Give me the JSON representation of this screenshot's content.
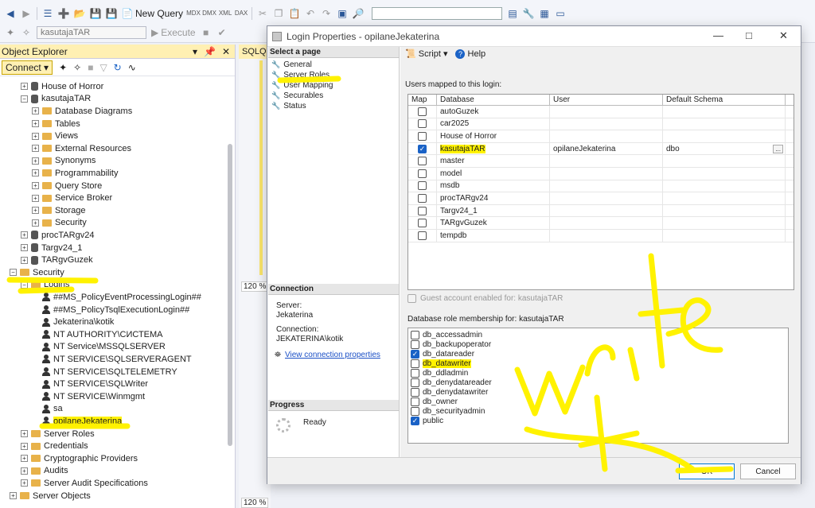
{
  "toolbar": {
    "new_query": "New Query",
    "database_value": "kasutajaTAR",
    "execute": "Execute"
  },
  "object_explorer": {
    "title": "Object Explorer",
    "connect": "Connect",
    "tree": [
      {
        "label": "House of Horror",
        "type": "db",
        "level": 1
      },
      {
        "label": "kasutajaTAR",
        "type": "db",
        "level": 1,
        "expanded": true
      },
      {
        "label": "Database Diagrams",
        "type": "folder",
        "level": 2
      },
      {
        "label": "Tables",
        "type": "folder",
        "level": 2
      },
      {
        "label": "Views",
        "type": "folder",
        "level": 2
      },
      {
        "label": "External Resources",
        "type": "folder",
        "level": 2
      },
      {
        "label": "Synonyms",
        "type": "folder",
        "level": 2
      },
      {
        "label": "Programmability",
        "type": "folder",
        "level": 2
      },
      {
        "label": "Query Store",
        "type": "folder",
        "level": 2
      },
      {
        "label": "Service Broker",
        "type": "folder",
        "level": 2
      },
      {
        "label": "Storage",
        "type": "folder",
        "level": 2
      },
      {
        "label": "Security",
        "type": "folder",
        "level": 2
      },
      {
        "label": "procTARgv24",
        "type": "db",
        "level": 1
      },
      {
        "label": "Targv24_1",
        "type": "db",
        "level": 1
      },
      {
        "label": "TARgvGuzek",
        "type": "db",
        "level": 1
      },
      {
        "label": "Security",
        "type": "folder",
        "level": 0,
        "expanded": true
      },
      {
        "label": "Logins",
        "type": "folder",
        "level": 1,
        "expanded": true
      },
      {
        "label": "##MS_PolicyEventProcessingLogin##",
        "type": "user",
        "level": 2
      },
      {
        "label": "##MS_PolicyTsqlExecutionLogin##",
        "type": "user",
        "level": 2
      },
      {
        "label": "Jekaterina\\kotik",
        "type": "user",
        "level": 2
      },
      {
        "label": "NT AUTHORITY\\СИСТЕМА",
        "type": "user",
        "level": 2
      },
      {
        "label": "NT Service\\MSSQLSERVER",
        "type": "user",
        "level": 2
      },
      {
        "label": "NT SERVICE\\SQLSERVERAGENT",
        "type": "user",
        "level": 2
      },
      {
        "label": "NT SERVICE\\SQLTELEMETRY",
        "type": "user",
        "level": 2
      },
      {
        "label": "NT SERVICE\\SQLWriter",
        "type": "user",
        "level": 2
      },
      {
        "label": "NT SERVICE\\Winmgmt",
        "type": "user",
        "level": 2
      },
      {
        "label": "sa",
        "type": "user",
        "level": 2
      },
      {
        "label": "opilaneJekaterina",
        "type": "user",
        "level": 2,
        "selected": true
      },
      {
        "label": "Server Roles",
        "type": "folder",
        "level": 1
      },
      {
        "label": "Credentials",
        "type": "folder",
        "level": 1
      },
      {
        "label": "Cryptographic Providers",
        "type": "folder",
        "level": 1
      },
      {
        "label": "Audits",
        "type": "folder",
        "level": 1
      },
      {
        "label": "Server Audit Specifications",
        "type": "folder",
        "level": 1
      },
      {
        "label": "Server Objects",
        "type": "folder",
        "level": 0
      }
    ]
  },
  "editor": {
    "tab": "SQLQu",
    "zoom": "120 %",
    "zoom_bottom": "120 %"
  },
  "dialog": {
    "title": "Login Properties - opilaneJekaterina",
    "select_page": "Select a page",
    "pages": [
      "General",
      "Server Roles",
      "User Mapping",
      "Securables",
      "Status"
    ],
    "connection_header": "Connection",
    "server_label": "Server:",
    "server_value": "Jekaterina",
    "connection_label": "Connection:",
    "connection_value": "JEKATERINA\\kotik",
    "view_conn_props": "View connection properties",
    "progress_header": "Progress",
    "progress_status": "Ready",
    "script": "Script",
    "help": "Help",
    "users_mapped_label": "Users mapped to this login:",
    "columns": [
      "Map",
      "Database",
      "User",
      "Default Schema"
    ],
    "rows": [
      {
        "map": false,
        "db": "autoGuzek",
        "user": "",
        "schema": ""
      },
      {
        "map": false,
        "db": "car2025",
        "user": "",
        "schema": ""
      },
      {
        "map": false,
        "db": "House of Horror",
        "user": "",
        "schema": ""
      },
      {
        "map": true,
        "db": "kasutajaTAR",
        "user": "opilaneJekaterina",
        "schema": "dbo"
      },
      {
        "map": false,
        "db": "master",
        "user": "",
        "schema": ""
      },
      {
        "map": false,
        "db": "model",
        "user": "",
        "schema": ""
      },
      {
        "map": false,
        "db": "msdb",
        "user": "",
        "schema": ""
      },
      {
        "map": false,
        "db": "procTARgv24",
        "user": "",
        "schema": ""
      },
      {
        "map": false,
        "db": "Targv24_1",
        "user": "",
        "schema": ""
      },
      {
        "map": false,
        "db": "TARgvGuzek",
        "user": "",
        "schema": ""
      },
      {
        "map": false,
        "db": "tempdb",
        "user": "",
        "schema": ""
      }
    ],
    "ellipsis": "...",
    "guest_label": "Guest account enabled for: kasutajaTAR",
    "role_membership_label": "Database role membership for: kasutajaTAR",
    "roles": [
      {
        "name": "db_accessadmin",
        "checked": false
      },
      {
        "name": "db_backupoperator",
        "checked": false
      },
      {
        "name": "db_datareader",
        "checked": true
      },
      {
        "name": "db_datawriter",
        "checked": false
      },
      {
        "name": "db_ddladmin",
        "checked": false
      },
      {
        "name": "db_denydatareader",
        "checked": false
      },
      {
        "name": "db_denydatawriter",
        "checked": false
      },
      {
        "name": "db_owner",
        "checked": false
      },
      {
        "name": "db_securityadmin",
        "checked": false
      },
      {
        "name": "public",
        "checked": true
      }
    ],
    "ok": "OK",
    "cancel": "Cancel"
  },
  "annotation_color": "#fff200"
}
